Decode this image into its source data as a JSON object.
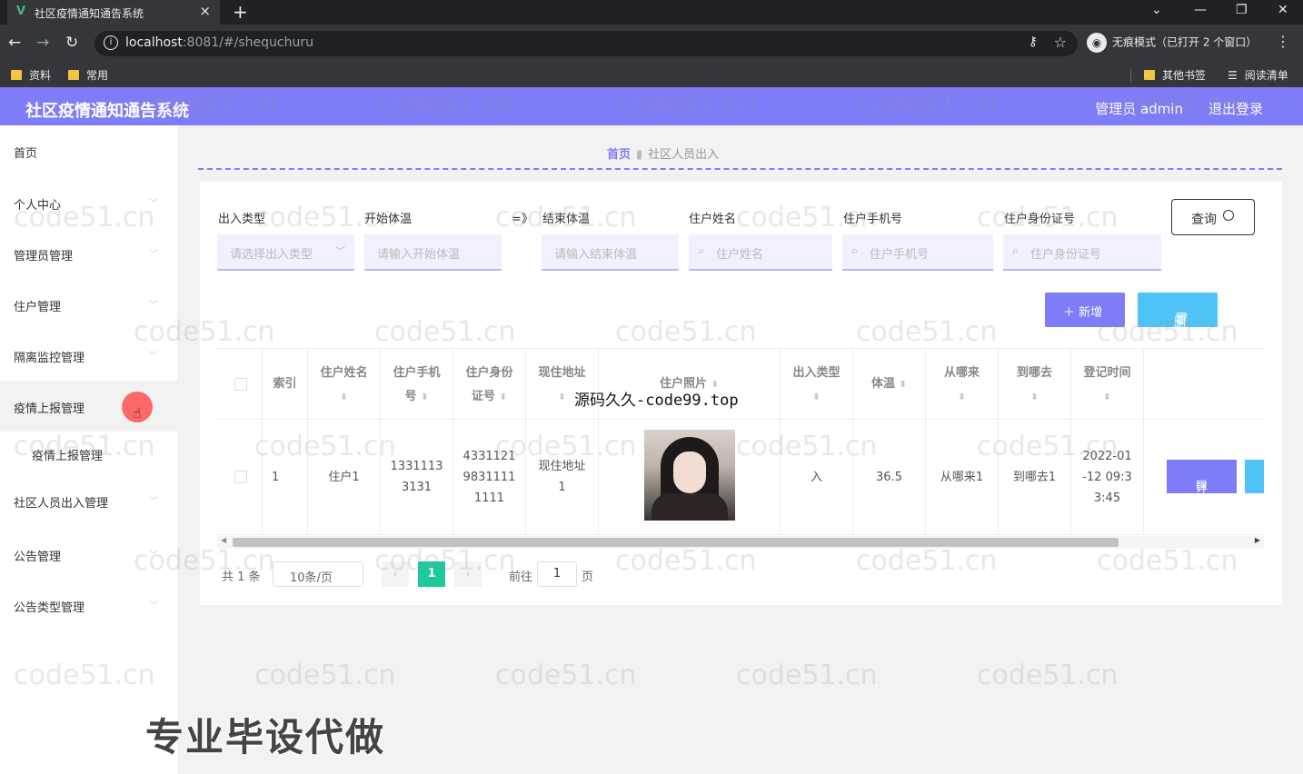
{
  "browser": {
    "tab_title": "社区疫情通知通告系统",
    "url_host": "localhost",
    "url_rest": ":8081/#/shequchuru",
    "incognito_label": "无痕模式（已打开 2 个窗口）",
    "bookmarks": [
      "资料",
      "常用"
    ],
    "bookmarks_right": [
      "其他书签",
      "阅读清单"
    ]
  },
  "header": {
    "title": "社区疫情通知通告系统",
    "admin": "管理员 admin",
    "logout": "退出登录",
    "accent": "#7f7cf7"
  },
  "sidebar": {
    "items": [
      "首页",
      "个人中心",
      "管理员管理",
      "住户管理",
      "隔离监控管理",
      "疫情上报管理",
      "社区人员出入管理",
      "公告管理",
      "公告类型管理"
    ],
    "subitem": "疫情上报管理"
  },
  "breadcrumb": {
    "home": "首页",
    "current": "社区人员出入"
  },
  "filters": {
    "type_label": "出入类型",
    "type_placeholder": "请选择出入类型",
    "start_label": "开始体温",
    "start_placeholder": "请输入开始体温",
    "range_sep": "=》",
    "end_label": "结束体温",
    "end_placeholder": "请输入结束体温",
    "name_label": "住户姓名",
    "name_placeholder": "住户姓名",
    "phone_label": "住户手机号",
    "phone_placeholder": "住户手机号",
    "id_label": "住户身份证号",
    "id_placeholder": "住户身份证号",
    "query_button": "查询"
  },
  "actions": {
    "add": "＋ 新增",
    "delete": "删除"
  },
  "table": {
    "headers": [
      "索引",
      "住户姓名",
      "住户手机号",
      "住户身份证号",
      "现住地址",
      "住户照片",
      "出入类型",
      "体温",
      "从哪来",
      "到哪去",
      "登记时间"
    ],
    "row": {
      "index": "1",
      "name": "住户1",
      "phone": "13311133131",
      "id_card": "433112198311111111",
      "address": "现住地址1",
      "type": "入",
      "temp": "36.5",
      "from": "从哪来1",
      "to": "到哪去1",
      "time": "2022-01-12 09:33:45"
    },
    "detail_button": "详情"
  },
  "pagination": {
    "total": "共 1 条",
    "size": "10条/页",
    "current": "1",
    "goto": "前往",
    "page_input": "1",
    "page_suffix": "页"
  },
  "overlays": {
    "watermark": "code51.cn",
    "code_text": "源码久久-code99.top",
    "big_text": "专业毕设代做"
  }
}
